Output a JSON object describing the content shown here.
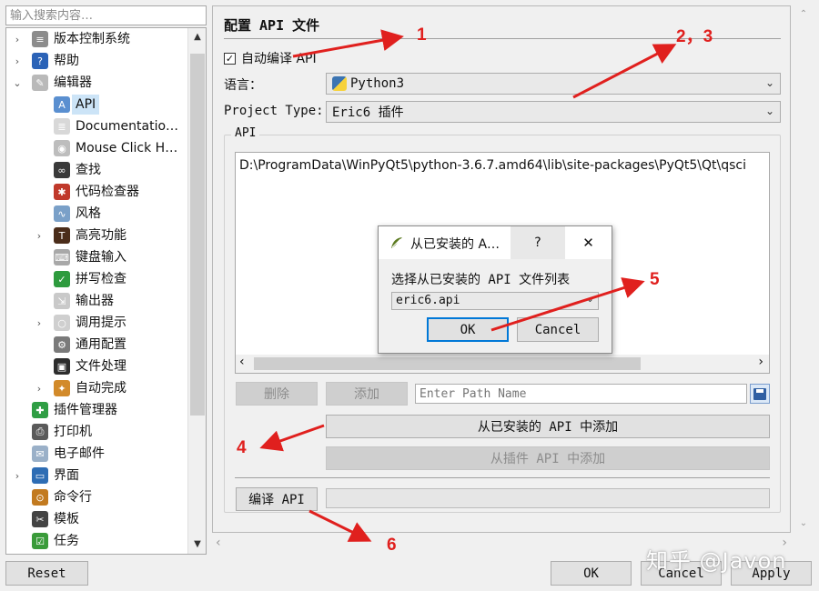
{
  "search": {
    "placeholder": "输入搜索内容…"
  },
  "tree": {
    "items": [
      {
        "label": "版本控制系统",
        "icon": "database-icon",
        "level": 0,
        "expander": "›"
      },
      {
        "label": "帮助",
        "icon": "help-icon",
        "level": 0,
        "expander": "›"
      },
      {
        "label": "编辑器",
        "icon": "editor-icon",
        "level": 0,
        "expander": "⌄"
      },
      {
        "label": "API",
        "icon": "api-icon",
        "level": 1,
        "expander": "",
        "selected": true
      },
      {
        "label": "Documentatio…",
        "icon": "document-icon",
        "level": 1,
        "expander": ""
      },
      {
        "label": "Mouse Click H…",
        "icon": "mouse-icon",
        "level": 1,
        "expander": ""
      },
      {
        "label": "查找",
        "icon": "binoculars-icon",
        "level": 1,
        "expander": ""
      },
      {
        "label": "代码检查器",
        "icon": "bug-icon",
        "level": 1,
        "expander": ""
      },
      {
        "label": "风格",
        "icon": "style-icon",
        "level": 1,
        "expander": ""
      },
      {
        "label": "高亮功能",
        "icon": "font-icon",
        "level": 1,
        "expander": "›"
      },
      {
        "label": "键盘输入",
        "icon": "keyboard-icon",
        "level": 1,
        "expander": ""
      },
      {
        "label": "拼写检查",
        "icon": "spellcheck-icon",
        "level": 1,
        "expander": ""
      },
      {
        "label": "输出器",
        "icon": "export-icon",
        "level": 1,
        "expander": ""
      },
      {
        "label": "调用提示",
        "icon": "lightbulb-icon",
        "level": 1,
        "expander": "›"
      },
      {
        "label": "通用配置",
        "icon": "wrench-icon",
        "level": 1,
        "expander": ""
      },
      {
        "label": "文件处理",
        "icon": "floppy-icon",
        "level": 1,
        "expander": ""
      },
      {
        "label": "自动完成",
        "icon": "autocomplete-icon",
        "level": 1,
        "expander": "›"
      },
      {
        "label": "插件管理器",
        "icon": "plugin-icon",
        "level": 0,
        "expander": ""
      },
      {
        "label": "打印机",
        "icon": "printer-icon",
        "level": 0,
        "expander": ""
      },
      {
        "label": "电子邮件",
        "icon": "email-icon",
        "level": 0,
        "expander": ""
      },
      {
        "label": "界面",
        "icon": "monitor-icon",
        "level": 0,
        "expander": "›"
      },
      {
        "label": "命令行",
        "icon": "terminal-icon",
        "level": 0,
        "expander": ""
      },
      {
        "label": "模板",
        "icon": "scissors-icon",
        "level": 0,
        "expander": ""
      },
      {
        "label": "任务",
        "icon": "task-icon",
        "level": 0,
        "expander": ""
      }
    ]
  },
  "panel": {
    "title": "配置 API 文件",
    "auto_compile_label": "自动编译 API",
    "auto_compile_checked": "✓",
    "language_label": "语言：",
    "language_value": "Python3",
    "project_type_label": "Project Type:",
    "project_type_value": "Eric6 插件",
    "api_group_label": "API",
    "api_path": "D:\\ProgramData\\WinPyQt5\\python-3.6.7.amd64\\lib\\site-packages\\PyQt5\\Qt\\qsci",
    "delete_button": "删除",
    "add_button": "添加",
    "path_placeholder": "Enter Path Name",
    "add_installed_button": "从已安装的 API 中添加",
    "add_plugin_button": "从插件 API 中添加",
    "compile_button": "编译 API"
  },
  "dialog": {
    "title": "从已安装的 A…",
    "help": "?",
    "close": "✕",
    "prompt": "选择从已安装的 API 文件列表",
    "selected": "eric6.api",
    "ok": "OK",
    "cancel": "Cancel"
  },
  "footer": {
    "reset": "Reset",
    "ok": "OK",
    "cancel": "Cancel",
    "apply": "Apply"
  },
  "annotations": {
    "n1": "1",
    "n23": "2，3",
    "n4": "4",
    "n5": "5",
    "n6": "6",
    "color": "#e0201e"
  },
  "watermark": "知乎 @Javon",
  "colors": {
    "selection": "#cce4f7",
    "accent": "#0078d7"
  }
}
